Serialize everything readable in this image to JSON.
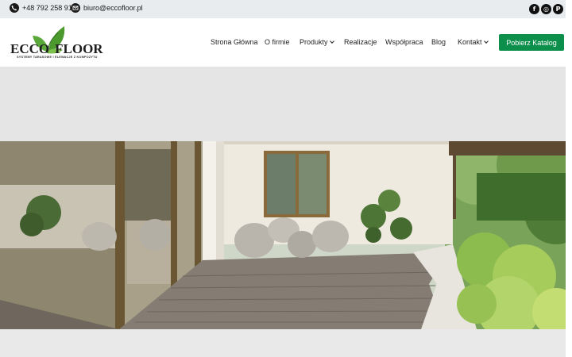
{
  "topbar": {
    "phone": "+48 792 258 915",
    "email": "biuro@eccofloor.pl",
    "social": [
      {
        "icon": "facebook-icon",
        "glyph": "f"
      },
      {
        "icon": "instagram-icon",
        "glyph": "◎"
      },
      {
        "icon": "pinterest-icon",
        "glyph": "P"
      }
    ]
  },
  "logo": {
    "name_part1": "ECCO",
    "name_part2": "FLOOR",
    "tagline": "SYSTEMY TARASOWE I ELEWACJE Z KOMPOZYTU"
  },
  "nav": {
    "items": [
      {
        "label": "Strona Główna",
        "dropdown": false
      },
      {
        "label": "O firmie",
        "dropdown": false
      },
      {
        "label": "Produkty",
        "dropdown": true
      },
      {
        "label": "Realizacje",
        "dropdown": false
      },
      {
        "label": "Współpraca",
        "dropdown": false
      },
      {
        "label": "Blog",
        "dropdown": false
      },
      {
        "label": "Kontakt",
        "dropdown": true
      }
    ],
    "cta_label": "Pobierz Katalog"
  },
  "colors": {
    "accent": "#0d8f4c",
    "logo_leaf": "#5aa83a",
    "text": "#1f1f1f"
  },
  "hero": {
    "image": "terrace-photo"
  }
}
